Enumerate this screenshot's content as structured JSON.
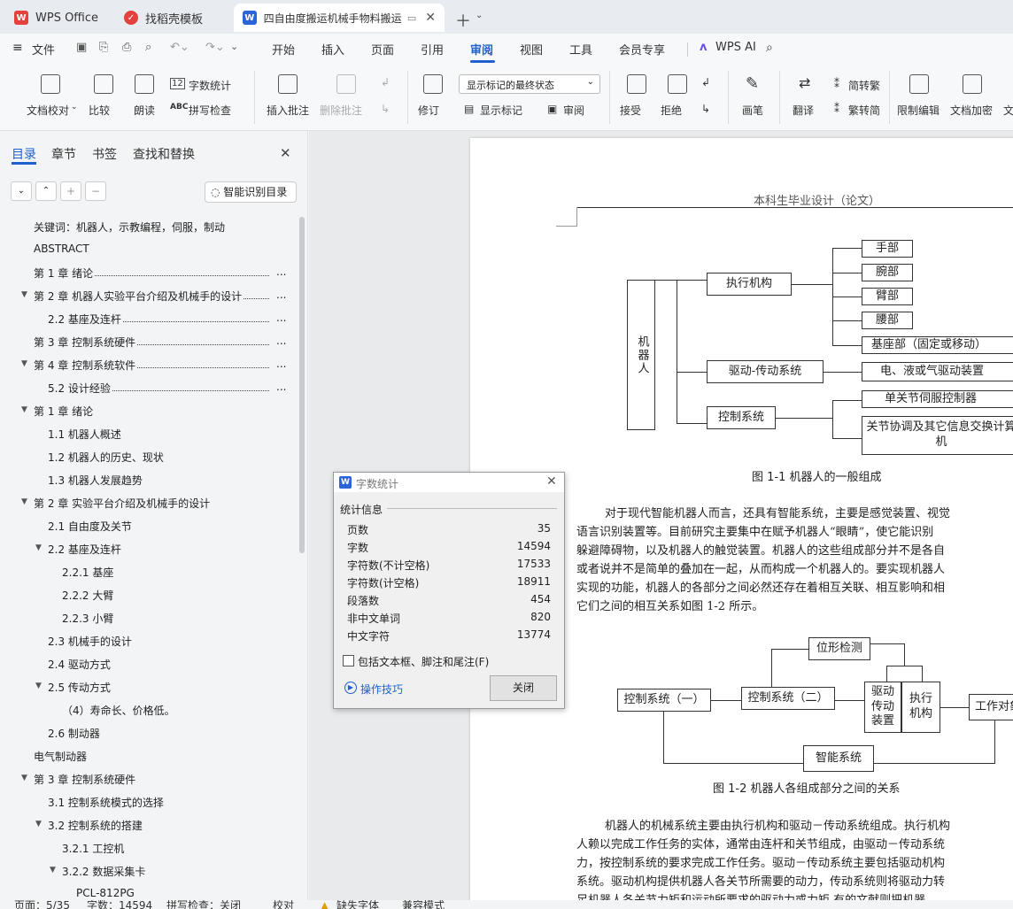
{
  "tabs": [
    {
      "label": "WPS Office"
    },
    {
      "label": "找稻壳模板"
    },
    {
      "label": "四自由度搬运机械手物料搬运"
    }
  ],
  "menu": {
    "file": "文件",
    "items": [
      "开始",
      "插入",
      "页面",
      "引用",
      "审阅",
      "视图",
      "工具",
      "会员专享"
    ],
    "active": "审阅",
    "ai": "WPS AI"
  },
  "ribbon": {
    "proofread": "文档校对",
    "compare": "比较",
    "read_aloud": "朗读",
    "word_count": "字数统计",
    "spell_check": "拼写检查",
    "insert_comment": "插入批注",
    "delete_comment": "删除批注",
    "revise": "修订",
    "markup_select": "显示标记的最终状态",
    "show_markup": "显示标记",
    "review": "审阅",
    "accept": "接受",
    "reject": "拒绝",
    "pen": "画笔",
    "translate": "翻译",
    "trad": "简转繁",
    "simp": "繁转简",
    "restrict": "限制编辑",
    "encrypt": "文档加密",
    "more": "文"
  },
  "nav": {
    "tabs": [
      "目录",
      "章节",
      "书签",
      "查找和替换"
    ],
    "smart_toc": "智能识别目录",
    "items": [
      {
        "text": "关键词：机器人，示教编程，伺服，制动",
        "level": 0,
        "tri": false,
        "dots": false
      },
      {
        "text": "ABSTRACT",
        "level": 0,
        "tri": false,
        "dots": false
      },
      {
        "text": "第 1 章  绪论",
        "level": 0,
        "tri": false,
        "dots": true
      },
      {
        "text": "第 2 章  机器人实验平台介绍及机械手的设计",
        "level": 0,
        "tri": true,
        "dots": true
      },
      {
        "text": "2.2  基座及连杆",
        "level": 1,
        "tri": false,
        "dots": true
      },
      {
        "text": "第 3 章  控制系统硬件",
        "level": 0,
        "tri": false,
        "dots": true
      },
      {
        "text": "第 4 章  控制系统软件",
        "level": 0,
        "tri": true,
        "dots": true
      },
      {
        "text": "5.2  设计经验",
        "level": 1,
        "tri": false,
        "dots": true
      },
      {
        "text": "第 1 章  绪论",
        "level": 0,
        "tri": true,
        "dots": false
      },
      {
        "text": "1.1  机器人概述",
        "level": 1,
        "tri": false,
        "dots": false
      },
      {
        "text": "1.2  机器人的历史、现状",
        "level": 1,
        "tri": false,
        "dots": false
      },
      {
        "text": "1.3 机器人发展趋势",
        "level": 1,
        "tri": false,
        "dots": false
      },
      {
        "text": "第 2 章  实验平台介绍及机械手的设计",
        "level": 0,
        "tri": true,
        "dots": false
      },
      {
        "text": "2.1 自由度及关节",
        "level": 1,
        "tri": false,
        "dots": false
      },
      {
        "text": "2.2 基座及连杆",
        "level": 1,
        "tri": true,
        "dots": false
      },
      {
        "text": "2.2.1  基座",
        "level": 2,
        "tri": false,
        "dots": false
      },
      {
        "text": "2.2.2  大臂",
        "level": 2,
        "tri": false,
        "dots": false
      },
      {
        "text": "2.2.3  小臂",
        "level": 2,
        "tri": false,
        "dots": false
      },
      {
        "text": "2.3 机械手的设计",
        "level": 1,
        "tri": false,
        "dots": false
      },
      {
        "text": "2.4 驱动方式",
        "level": 1,
        "tri": false,
        "dots": false
      },
      {
        "text": "2.5 传动方式",
        "level": 1,
        "tri": true,
        "dots": false
      },
      {
        "text": "（4）寿命长、价格低。",
        "level": 2,
        "tri": false,
        "dots": false
      },
      {
        "text": "2.6 制动器",
        "level": 1,
        "tri": false,
        "dots": false
      },
      {
        "text": "电气制动器",
        "level": 0,
        "tri": false,
        "dots": false
      },
      {
        "text": "第 3 章  控制系统硬件",
        "level": 0,
        "tri": true,
        "dots": false
      },
      {
        "text": "3.1  控制系统模式的选择",
        "level": 1,
        "tri": false,
        "dots": false
      },
      {
        "text": "3.2 控制系统的搭建",
        "level": 1,
        "tri": true,
        "dots": false
      },
      {
        "text": "3.2.1 工控机",
        "level": 2,
        "tri": false,
        "dots": false
      },
      {
        "text": "3.2.2 数据采集卡",
        "level": 2,
        "tri": true,
        "dots": false
      },
      {
        "text": "PCL-812PG",
        "level": 3,
        "tri": false,
        "dots": false
      }
    ]
  },
  "doc": {
    "header": "本科生毕业设计（论文）",
    "fig1": {
      "root": "机器人",
      "exec": "执行机构",
      "drive": "驱动-传动系统",
      "ctrl": "控制系统",
      "hand": "手部",
      "wrist": "腕部",
      "arm": "臂部",
      "waist": "腰部",
      "base": "基座部（固定或移动）",
      "power": "电、液或气驱动装置",
      "servo": "单关节伺服控制器",
      "coord": "关节协调及其它信息交换计算机",
      "caption": "图 1-1  机器人的一般组成"
    },
    "para1": [
      "对于现代智能机器人而言，还具有智能系统，主要是感觉装置、视觉",
      "语言识别装置等。目前研究主要集中在赋予机器人“眼睛”，使它能识别",
      "躲避障碍物，以及机器人的触觉装置。机器人的这些组成部分并不是各自",
      "或者说并不是简单的叠加在一起，从而构成一个机器人的。要实现机器人",
      "实现的功能，机器人的各部分之间必然还存在着相互关联、相互影响和相",
      "它们之间的相互关系如图 1-2 所示。"
    ],
    "fig2": {
      "pos": "位形检测",
      "ctrl1": "控制系统（一）",
      "ctrl2": "控制系统（二）",
      "drive": "驱动传动装置",
      "exec": "执行机构",
      "work": "工作对象",
      "smart": "智能系统",
      "caption": "图 1-2  机器人各组成部分之间的关系"
    },
    "para2": [
      "机器人的机械系统主要由执行机构和驱动－传动系统组成。执行机构",
      "人赖以完成工作任务的实体，通常由连杆和关节组成，由驱动－传动系统",
      "力，按控制系统的要求完成工作任务。驱动－传动系统主要包括驱动机构",
      "系统。驱动机构提供机器人各关节所需要的动力，传动系统则将驱动力转",
      "足机器人各关节力矩和运动所要求的驱动力或力矩  有的文献则把机器"
    ]
  },
  "dialog": {
    "title": "字数统计",
    "section": "统计信息",
    "rows": [
      {
        "label": "页数",
        "value": "35"
      },
      {
        "label": "字数",
        "value": "14594"
      },
      {
        "label": "字符数(不计空格)",
        "value": "17533"
      },
      {
        "label": "字符数(计空格)",
        "value": "18911"
      },
      {
        "label": "段落数",
        "value": "454"
      },
      {
        "label": "非中文单词",
        "value": "820"
      },
      {
        "label": "中文字符",
        "value": "13774"
      }
    ],
    "checkbox": "包括文本框、脚注和尾注(F)",
    "tips": "操作技巧",
    "close": "关闭"
  },
  "status": {
    "page": "页面：5/35",
    "words": "字数：14594",
    "spell": "拼写检查：关闭",
    "proof": "校对",
    "font": "缺失字体",
    "mode": "兼容模式"
  },
  "colors": {
    "accent": "#1f5fcf",
    "wps_red": "#e5413c",
    "doc_blue": "#2a64d6"
  }
}
